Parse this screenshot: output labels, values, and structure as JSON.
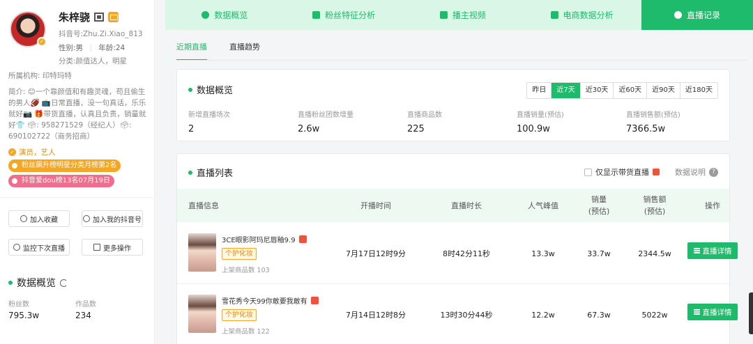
{
  "profile": {
    "name": "朱梓骁",
    "douyin_id": "抖音号:Zhu.Zi.Xiao_813",
    "gender": "性别:男",
    "age": "年龄:24",
    "category": "分类:颜值达人，明星",
    "org": "所属机构: 印特玛特",
    "intro": "简介: 😊一个靠颜值和有趣灵魂，苟且偷生的男人🏈 📺日常直播，没一句真话，乐乐就好📷 🎁带货直播，认真且负责，销量就好👕 🗳: 958271529（经纪人）🗳: 690102722（商务招商）",
    "tag": "演员，艺人",
    "badge1": "粉丝飙升榜明星分类月榜第2名",
    "badge2": "抖音爱dou榜13名07月19日",
    "actions": {
      "favorite": "加入收藏",
      "add_douyin": "加入我的抖音号",
      "monitor": "监控下次直播",
      "more": "更多操作"
    },
    "overview_title": "数据概览",
    "fans_label": "粉丝数",
    "fans_value": "795.3w",
    "works_label": "作品数",
    "works_value": "234"
  },
  "tabs": [
    "数据概览",
    "粉丝特征分析",
    "播主视频",
    "电商数据分析",
    "直播记录"
  ],
  "subtabs": [
    "近期直播",
    "直播趋势"
  ],
  "overview": {
    "title": "数据概览",
    "ranges": [
      "昨日",
      "近7天",
      "近30天",
      "近60天",
      "近90天",
      "近180天"
    ],
    "active_range": "近7天",
    "kpis": [
      {
        "label": "新增直播场次",
        "value": "2"
      },
      {
        "label": "直播粉丝团数增量",
        "value": "2.6w"
      },
      {
        "label": "直播商品数",
        "value": "225"
      },
      {
        "label": "直播销量(预估)",
        "value": "100.9w"
      },
      {
        "label": "直播销售额(预估)",
        "value": "7366.5w"
      }
    ]
  },
  "live_list": {
    "title": "直播列表",
    "only_goods": "仅显示带货直播",
    "explain": "数据说明",
    "columns": {
      "info": "直播信息",
      "start": "开播时间",
      "duration": "直播时长",
      "peak": "人气峰值",
      "sales_1": "销量",
      "sales_2": "(预估)",
      "revenue_1": "销售额",
      "revenue_2": "(预估)",
      "action": "操作"
    },
    "rows": [
      {
        "title": "3CE眼影阿玛尼唇釉9.9",
        "category": "个护化妆",
        "shelf": "上架商品数 103",
        "start": "7月17日12时9分",
        "duration": "8时42分11秒",
        "peak": "13.3w",
        "sales": "33.7w",
        "revenue": "2344.5w",
        "btn": "直播详情"
      },
      {
        "title": "雪花秀今天99你敢要我敢有",
        "category": "个护化妆",
        "shelf": "上架商品数 122",
        "start": "7月14日12时8分",
        "duration": "13时30分44秒",
        "peak": "12.2w",
        "sales": "67.3w",
        "revenue": "5022w",
        "btn": "直播详情"
      }
    ]
  }
}
